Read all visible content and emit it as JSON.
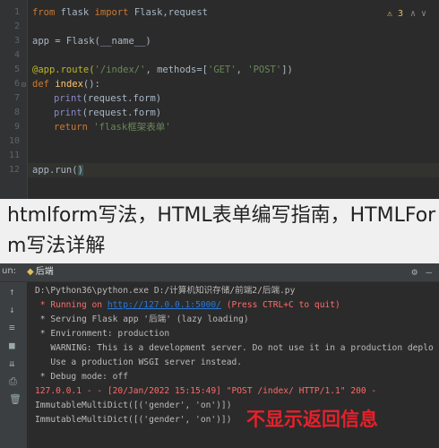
{
  "editor": {
    "line_numbers": [
      "1",
      "2",
      "3",
      "4",
      "5",
      "6",
      "7",
      "8",
      "9",
      "10",
      "11",
      "12"
    ],
    "warning_count": "3",
    "code": {
      "l1_from": "from",
      "l1_mod": " flask ",
      "l1_import": "import",
      "l1_names": " Flask,request",
      "l3": "app = Flask(__name__)",
      "l5_deco": "@app.route(",
      "l5_str": "'/index/'",
      "l5_mid": ", methods=[",
      "l5_get": "'GET'",
      "l5_comma": ", ",
      "l5_post": "'POST'",
      "l5_end": "])",
      "l6_def": "def ",
      "l6_name": "index",
      "l6_end": "():",
      "l7_print": "print",
      "l7_arg": "(request.form)",
      "l8_print": "print",
      "l8_arg": "(request.form)",
      "l9_ret": "return ",
      "l9_str": "'flask框架表单'",
      "l12_a": "app.run(",
      "l12_b": ")"
    }
  },
  "overlay": {
    "title": "htmlform写法，HTML表单编写指南，HTMLForm写法详解"
  },
  "run_panel": {
    "label": "un:",
    "tab_name": "后端",
    "lines": {
      "c1": "D:\\Python36\\python.exe D:/计算机知识存储/前端2/后端.py",
      "c2_a": " * Running on ",
      "c2_link": "http://127.0.0.1:5000/",
      "c2_b": " (Press CTRL+C to quit)",
      "c3": " * Serving Flask app '后端' (lazy loading)",
      "c4": " * Environment: production",
      "c5": "   WARNING: This is a development server. Do not use it in a production deplo",
      "c6": "   Use a production WSGI server instead.",
      "c7": " * Debug mode: off",
      "c8": "127.0.0.1 - - [20/Jan/2022 15:15:49] \"POST /index/ HTTP/1.1\" 200 -",
      "c9": "ImmutableMultiDict([('gender', 'on')])",
      "c10": "ImmutableMultiDict([('gender', 'on')])"
    },
    "annotation": "不显示返回信息"
  },
  "colors": {
    "background": "#2b2b2b",
    "keyword": "#cc7832",
    "string": "#6a8759",
    "error_red": "#ff6b68",
    "link": "#287bde",
    "annotation": "#e8202a"
  }
}
